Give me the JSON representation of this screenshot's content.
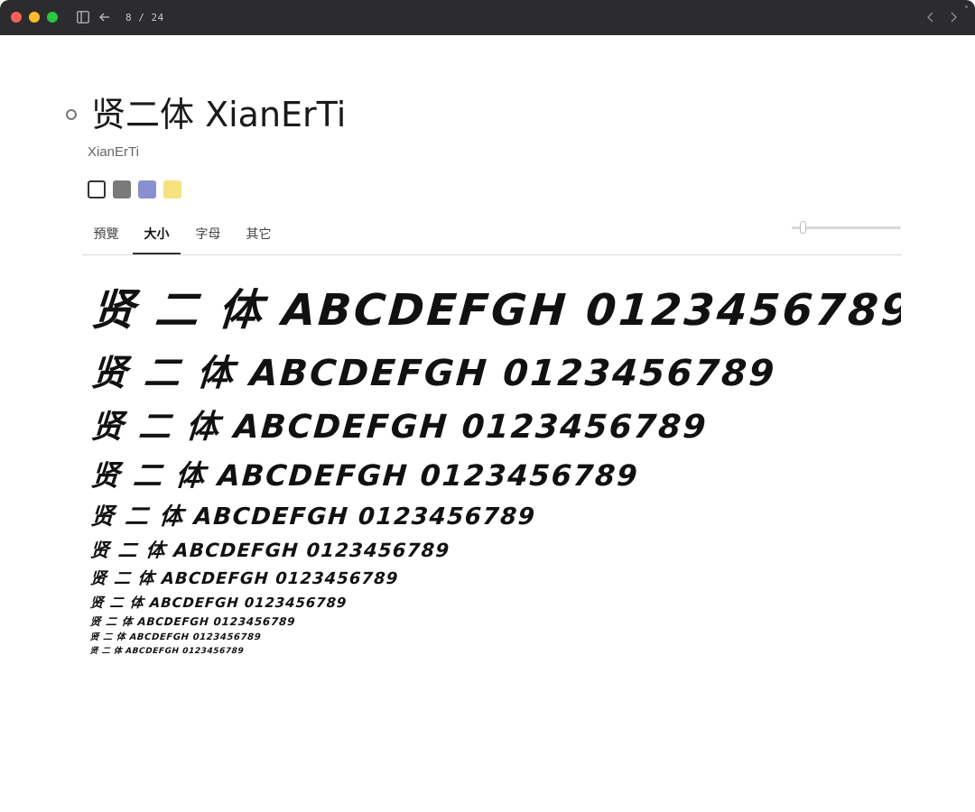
{
  "window": {
    "page_counter": "8 / 24"
  },
  "font": {
    "title": "贤二体 XianErTi",
    "subtitle": "XianErTi"
  },
  "swatches": [
    {
      "name": "white",
      "fill": "#ffffff",
      "border": "#333333"
    },
    {
      "name": "gray",
      "fill": "#7a7a7a",
      "border": "#7a7a7a"
    },
    {
      "name": "periwinkle",
      "fill": "#8a8fd0",
      "border": "#8a8fd0"
    },
    {
      "name": "yellow",
      "fill": "#f6e27f",
      "border": "#f6e27f"
    }
  ],
  "tabs": [
    {
      "label": "預覽",
      "active": false
    },
    {
      "label": "大小",
      "active": true
    },
    {
      "label": "字母",
      "active": false
    },
    {
      "label": "其它",
      "active": false
    }
  ],
  "size_slider": {
    "value_fraction": 0.08
  },
  "sample_text": "贤 二 体 ABCDEFGH 0123456789",
  "sample_sizes": [
    48,
    40,
    36,
    32,
    26,
    21,
    18,
    15,
    12,
    10,
    9
  ]
}
